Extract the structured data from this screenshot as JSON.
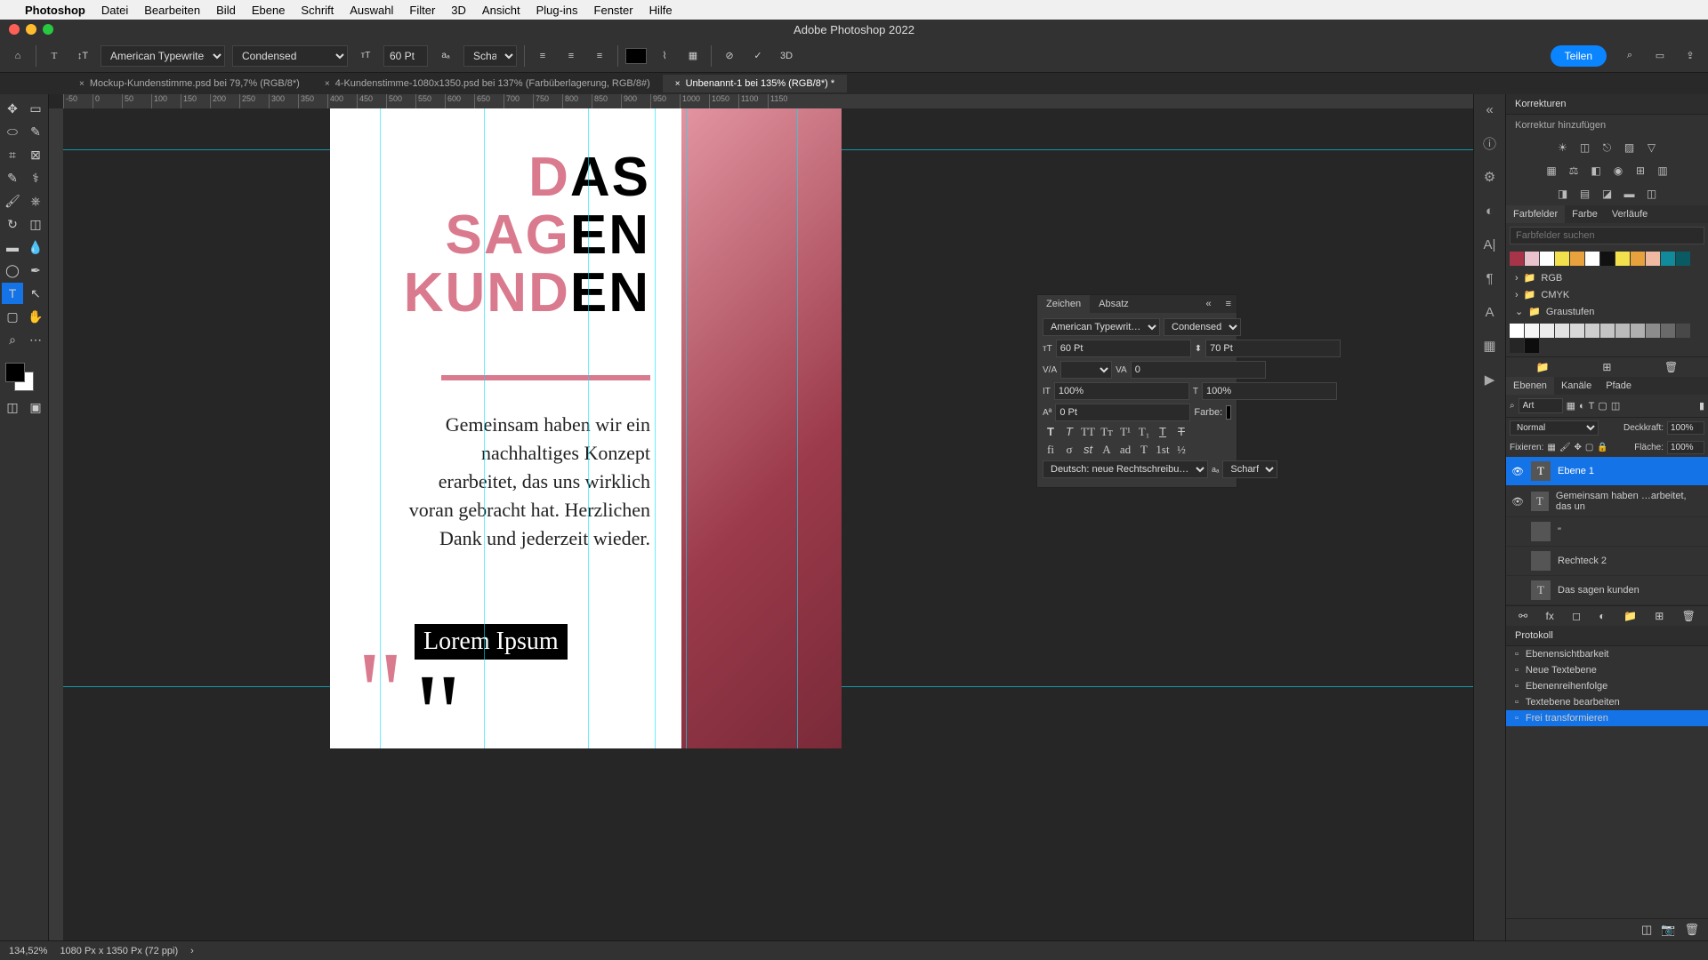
{
  "menubar": {
    "app": "Photoshop",
    "items": [
      "Datei",
      "Bearbeiten",
      "Bild",
      "Ebene",
      "Schrift",
      "Auswahl",
      "Filter",
      "3D",
      "Ansicht",
      "Plug-ins",
      "Fenster",
      "Hilfe"
    ]
  },
  "window_title": "Adobe Photoshop 2022",
  "options": {
    "font": "American Typewriter",
    "style": "Condensed",
    "size": "60 Pt",
    "aa": "Scharf",
    "teilen": "Teilen"
  },
  "tabs": [
    {
      "label": "Mockup-Kundenstimme.psd bei 79,7% (RGB/8*)",
      "active": false
    },
    {
      "label": "4-Kundenstimme-1080x1350.psd bei 137% (Farbüberlagerung, RGB/8#)",
      "active": false
    },
    {
      "label": "Unbenannt-1 bei 135% (RGB/8*) *",
      "active": true
    }
  ],
  "ruler": [
    "-50",
    "0",
    "50",
    "100",
    "150",
    "200",
    "250",
    "300",
    "350",
    "400",
    "450",
    "500",
    "550",
    "600",
    "650",
    "700",
    "750",
    "800",
    "850",
    "900",
    "950",
    "1000",
    "1050",
    "1100",
    "1150"
  ],
  "artboard": {
    "headline": {
      "l1_pink": "D",
      "l1_black": "AS",
      "l2_pink": "SAG",
      "l2_black": "EN",
      "l3_pink": "KUND",
      "l3_black": "EN"
    },
    "body": "Gemeinsam haben wir ein nachhaltiges Konzept erarbeitet, das uns wirklich voran gebracht hat. Herzlichen Dank und jederzeit wieder.",
    "lorem": "Lorem Ipsum"
  },
  "zeichen": {
    "tabs": [
      "Zeichen",
      "Absatz"
    ],
    "font": "American Typewrit…",
    "style": "Condensed",
    "size": "60 Pt",
    "leading": "70 Pt",
    "tracking": "0",
    "hscale": "100%",
    "vscale": "100%",
    "baseline": "0 Pt",
    "color_label": "Farbe:",
    "lang": "Deutsch: neue Rechtschreibu…",
    "aa": "Scharf"
  },
  "right": {
    "korrekturen": "Korrekturen",
    "korrektur_add": "Korrektur hinzufügen",
    "swatch_tabs": [
      "Farbfelder",
      "Farbe",
      "Verläufe"
    ],
    "swatch_search": "Farbfelder suchen",
    "folders": [
      "RGB",
      "CMYK",
      "Graustufen"
    ],
    "layers_tabs": [
      "Ebenen",
      "Kanäle",
      "Pfade"
    ],
    "art": "Art",
    "blend": "Normal",
    "opacity_label": "Deckkraft:",
    "opacity": "100%",
    "lock_label": "Fixieren:",
    "fill_label": "Fläche:",
    "fill": "100%",
    "layers": [
      {
        "name": "Ebene 1",
        "type": "T",
        "selected": true,
        "visible": true
      },
      {
        "name": "Gemeinsam haben …arbeitet, das un",
        "type": "T",
        "selected": false,
        "visible": true
      },
      {
        "name": "\"",
        "type": "shape",
        "selected": false,
        "visible": false
      },
      {
        "name": "Rechteck 2",
        "type": "shape",
        "selected": false,
        "visible": false
      },
      {
        "name": "Das  sagen kunden",
        "type": "T",
        "selected": false,
        "visible": false
      }
    ],
    "protokoll": "Protokoll",
    "history": [
      "Ebenensichtbarkeit",
      "Neue Textebene",
      "Ebenenreihenfolge",
      "Textebene bearbeiten",
      "Frei transformieren"
    ]
  },
  "status": {
    "zoom": "134,52%",
    "info": "1080 Px x 1350 Px (72 ppi)"
  },
  "swatch_colors": [
    "#a8344a",
    "#e9c2cd",
    "#ffffff",
    "#f2e14c",
    "#e8a23d",
    "#ffffff",
    "#111111",
    "#f2e14c",
    "#e8a23d",
    "#f0b9a2",
    "#118a9c",
    "#0a5a63"
  ],
  "gray_swatches": [
    "#ffffff",
    "#f6f6f6",
    "#ececec",
    "#e2e2e2",
    "#d8d8d8",
    "#cecece",
    "#c4c4c4",
    "#bababa",
    "#b0b0b0",
    "#8c8c8c",
    "#6a6a6a",
    "#484848",
    "#262626",
    "#0d0d0d"
  ]
}
